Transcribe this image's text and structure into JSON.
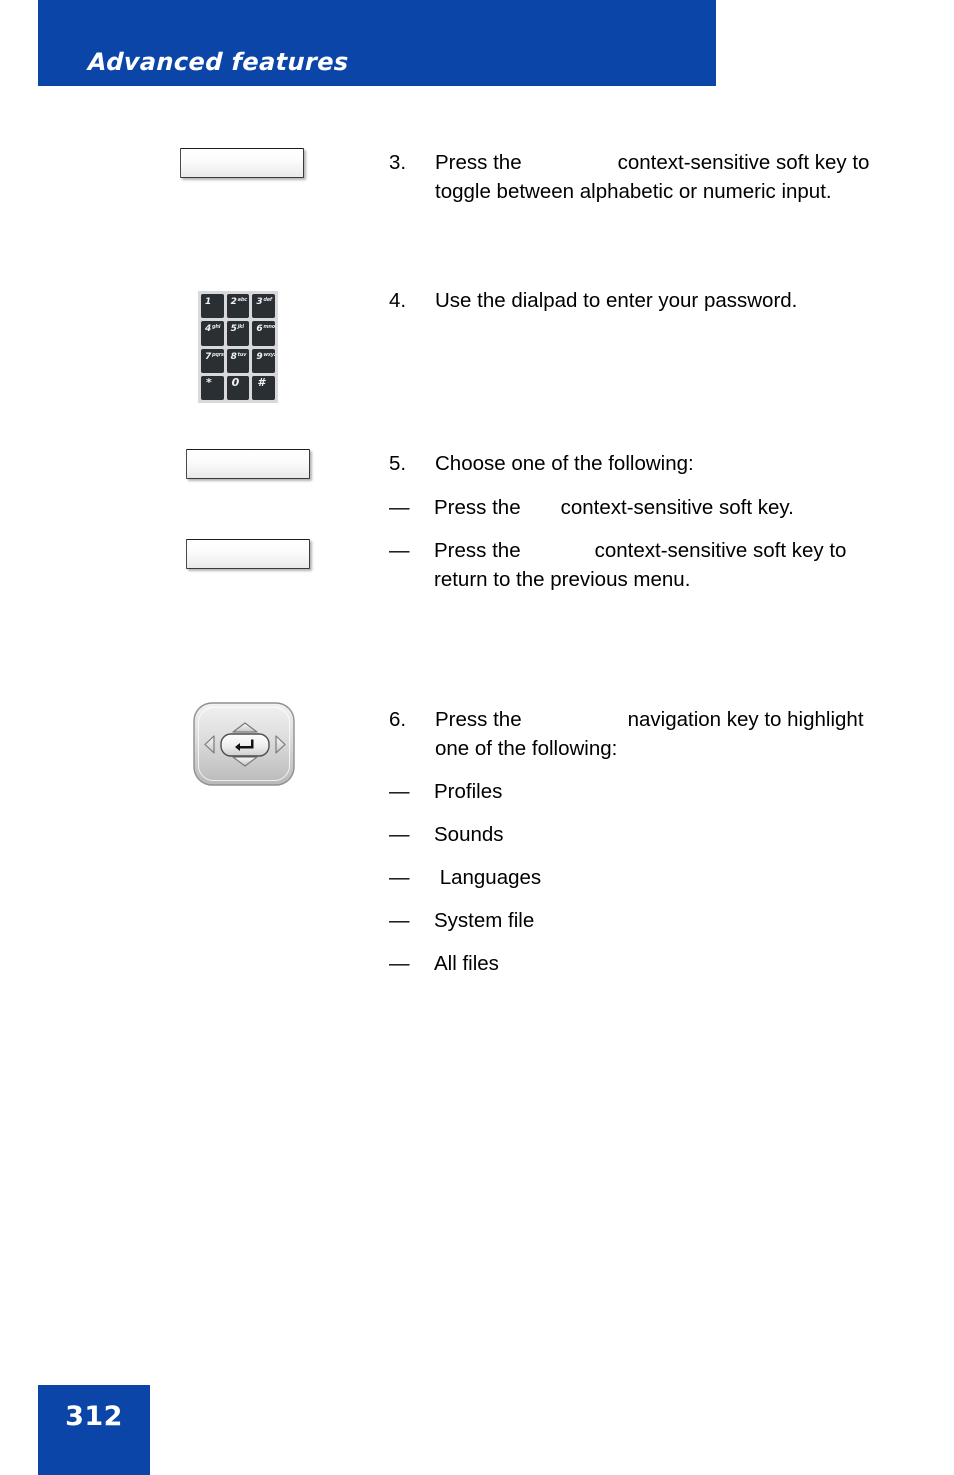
{
  "header": {
    "title": "Advanced features",
    "band_color": "#0B45A8"
  },
  "footer": {
    "page_number": "312",
    "box_color": "#0B45A8"
  },
  "steps": [
    {
      "number": "3.",
      "text_before_gap": "Press the",
      "text_after_gap": "context-sensitive soft key to toggle between alphabetic or numeric input.",
      "visual": "softkey-button"
    },
    {
      "number": "4.",
      "text_before_gap": "Use the dialpad to enter your password.",
      "text_after_gap": "",
      "visual": "dialpad"
    },
    {
      "number": "5.",
      "text_before_gap": "Choose one of the following:",
      "text_after_gap": "",
      "visual": "softkey-button-pair",
      "sub_items": [
        {
          "dash": "—",
          "text_before_gap": "Press the",
          "text_after_gap": "context-sensitive soft key."
        },
        {
          "dash": "—",
          "text_before_gap": "Press the",
          "text_after_gap": "context-sensitive soft key to return to the previous menu."
        }
      ]
    },
    {
      "number": "6.",
      "text_before_gap": "Press the",
      "text_after_gap": "navigation key to highlight one of the following:",
      "visual": "navigation-key",
      "sub_items": [
        {
          "dash": "—",
          "text": "Profiles"
        },
        {
          "dash": "—",
          "text": "Sounds"
        },
        {
          "dash": "—",
          "text": " Languages"
        },
        {
          "dash": "—",
          "text": "System file"
        },
        {
          "dash": "—",
          "text": "All files"
        }
      ]
    }
  ],
  "dialpad": {
    "keys": [
      {
        "digit": "1",
        "letters": ""
      },
      {
        "digit": "2",
        "letters": "abc"
      },
      {
        "digit": "3",
        "letters": "def"
      },
      {
        "digit": "4",
        "letters": "ghi"
      },
      {
        "digit": "5",
        "letters": "jkl"
      },
      {
        "digit": "6",
        "letters": "mno"
      },
      {
        "digit": "7",
        "letters": "pqrs"
      },
      {
        "digit": "8",
        "letters": "tuv"
      },
      {
        "digit": "9",
        "letters": "wxyz"
      },
      {
        "digit": "*",
        "letters": ""
      },
      {
        "digit": "0",
        "letters": ""
      },
      {
        "digit": "#",
        "letters": ""
      }
    ]
  },
  "navigation_key": {
    "up": "up-arrow",
    "down": "down-arrow",
    "left": "left-arrow",
    "right": "right-arrow",
    "center": "enter-key"
  }
}
